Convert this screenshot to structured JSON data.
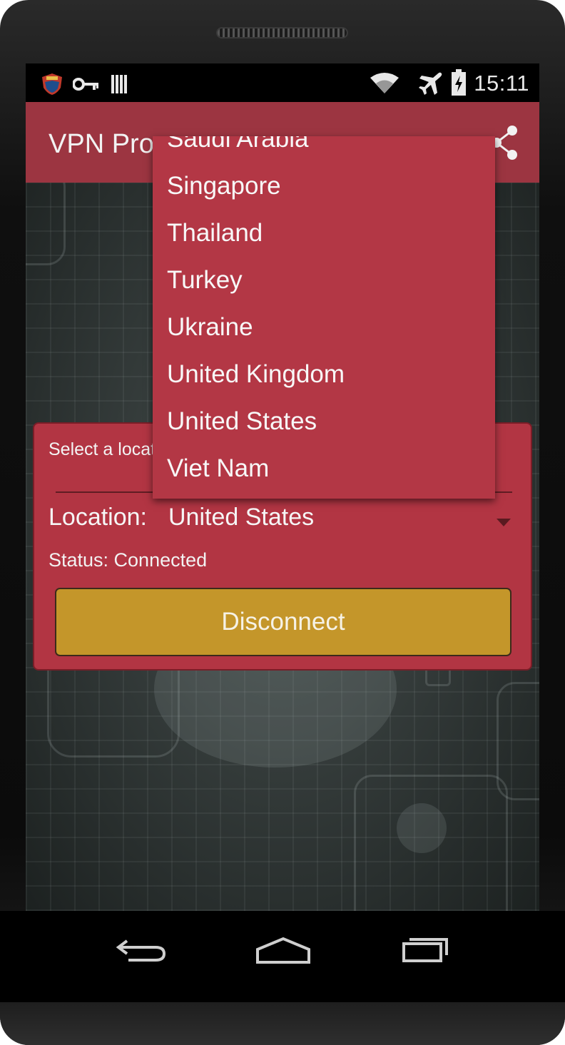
{
  "status_bar": {
    "time": "15:11",
    "icons": [
      "vpn-shield-icon",
      "key-icon",
      "sim-card-icon",
      "wifi-icon",
      "airplane-mode-icon",
      "battery-charging-icon"
    ]
  },
  "app_bar": {
    "title": "VPN Pro",
    "share_icon": "share-icon"
  },
  "card": {
    "hint": "Select a location and connect to VPN than click Connect",
    "location_label": "Location:",
    "location_value": "United States",
    "status_text": "Status: Connected",
    "disconnect_label": "Disconnect"
  },
  "dropdown": {
    "items": [
      "Saudi Arabia",
      "Singapore",
      "Thailand",
      "Turkey",
      "Ukraine",
      "United Kingdom",
      "United States",
      "Viet Nam"
    ]
  },
  "nav_bar": {
    "icons": [
      "back-icon",
      "home-icon",
      "recent-apps-icon"
    ]
  },
  "colors": {
    "app_bar": "#9c3541",
    "card": "#b23543",
    "dropdown": "#b33745",
    "button": "#c4962a"
  }
}
